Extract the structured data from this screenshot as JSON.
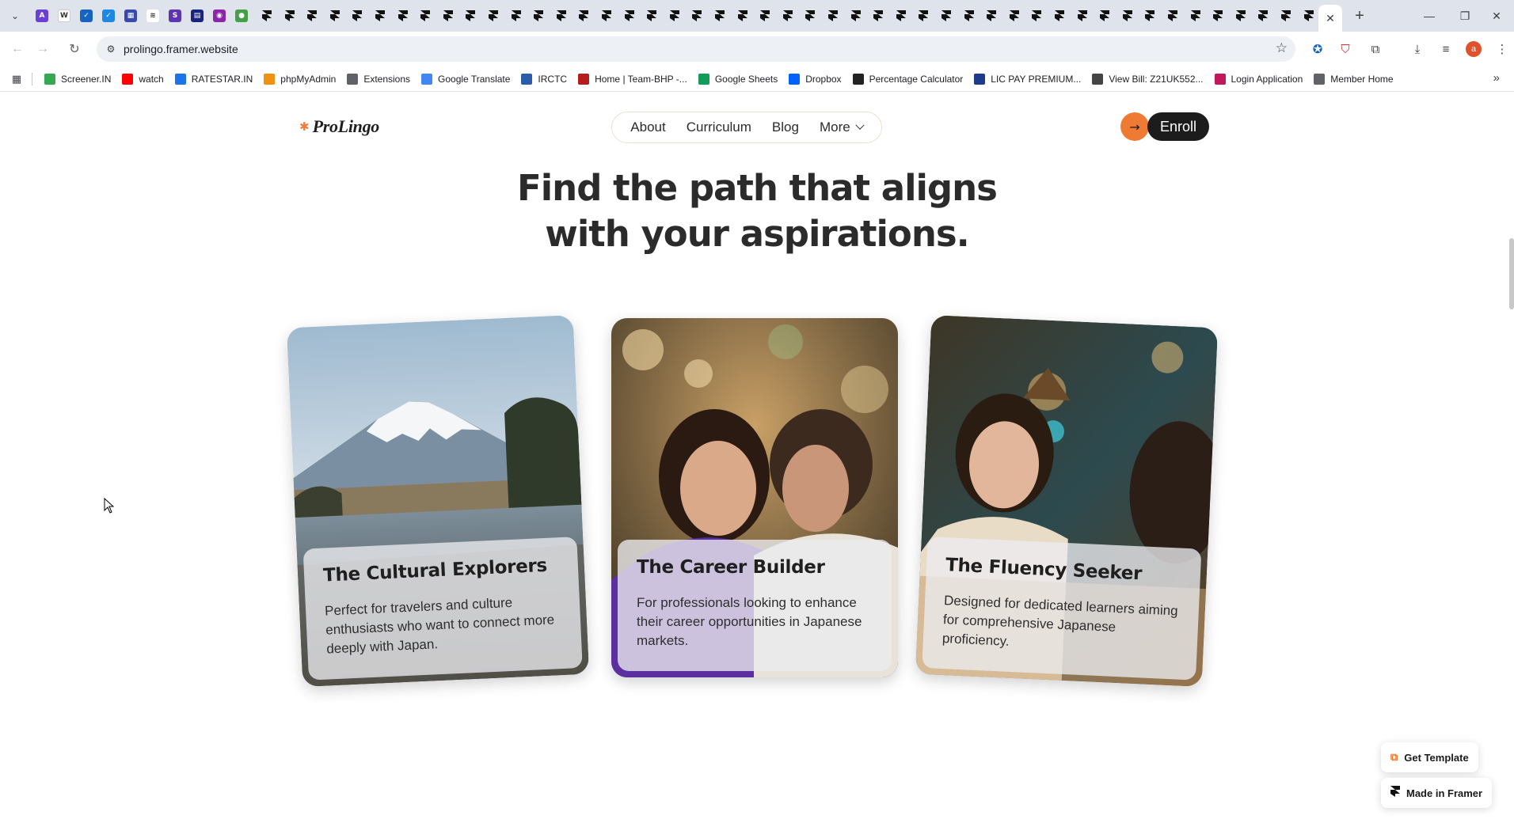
{
  "browser": {
    "address": "prolingo.framer.website",
    "bookmarks": [
      {
        "label": "Screener.IN",
        "icon": "bar-chart-icon",
        "color": "#34a853"
      },
      {
        "label": "watch",
        "icon": "youtube-icon",
        "color": "#ff0000"
      },
      {
        "label": "RATESTAR.IN",
        "icon": "ratestar-icon",
        "color": "#1a73e8"
      },
      {
        "label": "phpMyAdmin",
        "icon": "phpmyadmin-icon",
        "color": "#f29111"
      },
      {
        "label": "Extensions",
        "icon": "puzzle-icon",
        "color": "#5f6368"
      },
      {
        "label": "Google Translate",
        "icon": "translate-icon",
        "color": "#4285f4"
      },
      {
        "label": "IRCTC",
        "icon": "irctc-icon",
        "color": "#2a5caa"
      },
      {
        "label": "Home | Team-BHP -...",
        "icon": "teambhp-icon",
        "color": "#b71c1c"
      },
      {
        "label": "Google Sheets",
        "icon": "sheets-icon",
        "color": "#0f9d58"
      },
      {
        "label": "Dropbox",
        "icon": "dropbox-icon",
        "color": "#0061fe"
      },
      {
        "label": "Percentage Calculator",
        "icon": "percent-icon",
        "color": "#222222"
      },
      {
        "label": "LIC PAY PREMIUM...",
        "icon": "lic-icon",
        "color": "#1e3a8a"
      },
      {
        "label": "View Bill: Z21UK552...",
        "icon": "bill-icon",
        "color": "#444444"
      },
      {
        "label": "Login Application",
        "icon": "login-icon",
        "color": "#c2185b"
      },
      {
        "label": "Member Home",
        "icon": "globe-icon",
        "color": "#5f6368"
      }
    ]
  },
  "site": {
    "logo": "ProLingo",
    "nav": {
      "about": "About",
      "curriculum": "Curriculum",
      "blog": "Blog",
      "more": "More"
    },
    "enroll": "Enroll",
    "headline_1": "Find the path that aligns",
    "headline_2": "with your aspirations.",
    "cards": [
      {
        "title": "The Cultural Explorers",
        "desc": "Perfect for travelers and culture enthusiasts who want to connect more deeply with Japan."
      },
      {
        "title": "The Career Builder",
        "desc": "For professionals looking to enhance their career opportunities in Japanese markets."
      },
      {
        "title": "The Fluency Seeker",
        "desc": "Designed for dedicated learners aiming for comprehensive Japanese proficiency."
      }
    ],
    "get_template": "Get Template",
    "made_in_framer": "Made in Framer"
  },
  "colors": {
    "accent": "#ef7a34",
    "dark_button": "#1c1c1c",
    "heading": "#2b2b2b"
  }
}
